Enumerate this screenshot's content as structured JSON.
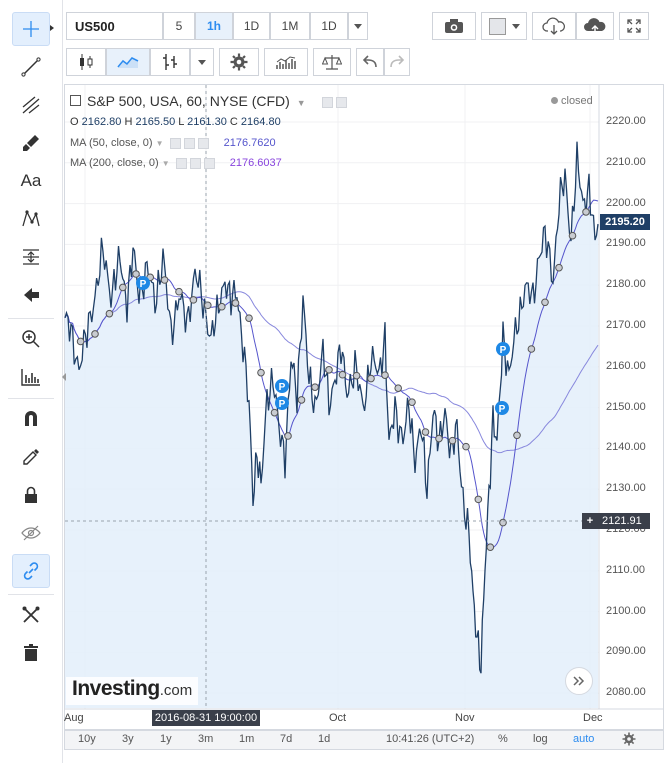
{
  "symbol": {
    "value": "US500"
  },
  "intervals": [
    "5",
    "1h",
    "1D",
    "1M",
    "1D"
  ],
  "active_interval": "1h",
  "legend": {
    "title": "S&P 500, USA, 60, NYSE (CFD)",
    "ohlc": {
      "o_label": "O",
      "o": "2162.80",
      "h_label": "H",
      "h": "2165.50",
      "l_label": "L",
      "l": "2161.30",
      "c_label": "C",
      "c": "2164.80"
    },
    "ma50": {
      "label": "MA (50, close, 0)",
      "value": "2176.7620"
    },
    "ma200": {
      "label": "MA (200, close, 0)",
      "value": "2176.6037"
    },
    "status": "closed"
  },
  "price_axis": [
    "2220.00",
    "2210.00",
    "2200.00",
    "2190.00",
    "2180.00",
    "2170.00",
    "2160.00",
    "2150.00",
    "2140.00",
    "2130.00",
    "2120.00",
    "2110.00",
    "2100.00",
    "2090.00",
    "2080.00"
  ],
  "last_price": "2195.20",
  "crosshair_price": "2121.91",
  "crosshair_price_plus": "+",
  "crosshair_time": "2016-08-31 19:00:00",
  "time_axis": [
    "Aug",
    "Oct",
    "Nov",
    "Dec"
  ],
  "watermark": {
    "brand": "Investing",
    "suffix": ".com"
  },
  "bottom_bar": {
    "ranges": [
      "10y",
      "3y",
      "1y",
      "3m",
      "1m",
      "7d",
      "1d"
    ],
    "clock": "10:41:26 (UTC+2)",
    "percent": "%",
    "log": "log",
    "auto": "auto"
  },
  "colors": {
    "price_line": "#1f3f66",
    "area_fill": "#e3eefa",
    "ma50": "#5555cc",
    "ma200": "#8888dd",
    "accent": "#2196f3",
    "marker": "#1e88e5",
    "last_price_bg": "#1f3f66"
  },
  "markers": {
    "label": "P"
  },
  "scroll_button_icon": "double-chevron-right-icon"
}
